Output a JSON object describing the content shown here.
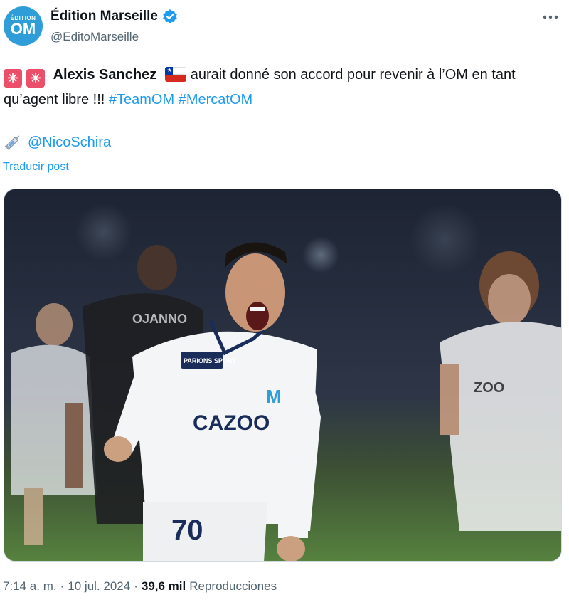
{
  "account": {
    "display_name": "Édition Marseille",
    "handle": "@EditoMarseille",
    "avatar_small": "ÉDITION",
    "avatar_big": "OM",
    "verified": true
  },
  "tweet": {
    "name": "Alexis Sanchez",
    "text": "aurait donné son accord pour revenir à l’OM en tant qu’agent libre !!!",
    "hashtag1": "#TeamOM",
    "hashtag2": "#MercatOM",
    "credit": "@NicoSchira",
    "translate_label": "Traducir post"
  },
  "photo": {
    "shirt_text": "CAZOO",
    "sponsor": "PARIONS SPORT",
    "club_logo": "M",
    "number": "70",
    "colors": {
      "pitch": "#4d7a3a",
      "shirt": "#f2f3f4",
      "crowd": "#1c2331"
    }
  },
  "footer": {
    "time": "7:14 a. m.",
    "separator": "·",
    "date": "10 jul. 2024",
    "views_count": "39,6 mil",
    "views_label": "Reproducciones"
  },
  "icons": {
    "verified": "verified-badge-icon",
    "more": "more-options-icon",
    "emoji": "sparkle-emoji-icon",
    "flag": "chile-flag-icon",
    "syringe": "syringe-emoji-icon"
  },
  "accent_color": "#1d9bf0"
}
